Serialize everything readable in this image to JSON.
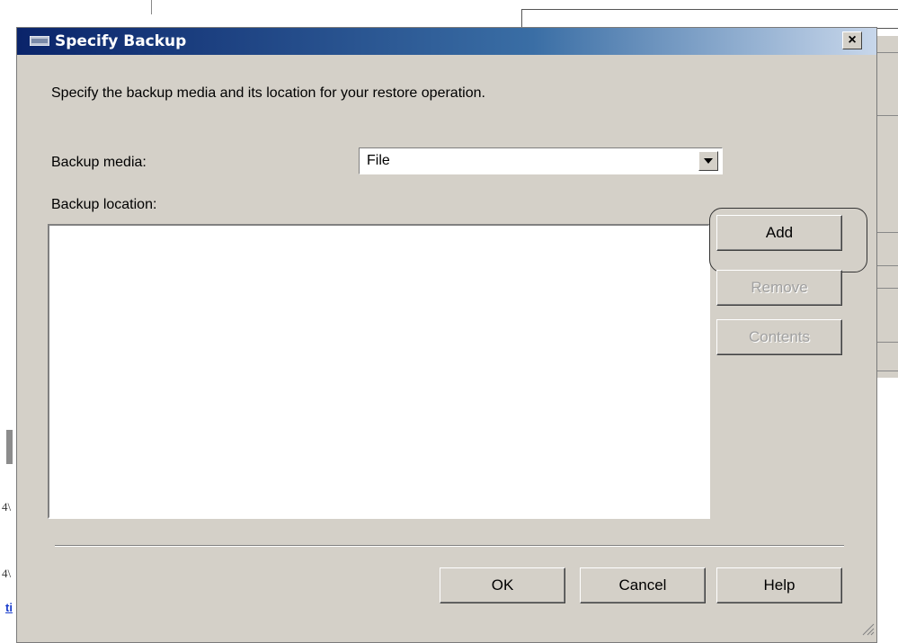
{
  "background": {
    "left_fragment_1": "4\\",
    "left_fragment_2": "4\\",
    "left_link": "ti"
  },
  "dialog": {
    "title": "Specify Backup",
    "close_label": "×",
    "description": "Specify the backup media and its location for your restore operation.",
    "backup_media_label": "Backup media:",
    "backup_media_value": "File",
    "backup_location_label": "Backup location:",
    "backup_locations": [],
    "buttons": {
      "add": "Add",
      "remove": "Remove",
      "contents": "Contents",
      "ok": "OK",
      "cancel": "Cancel",
      "help": "Help"
    }
  },
  "colors": {
    "dialog_bg": "#d4d0c8",
    "titlebar_start": "#0a246a",
    "titlebar_end": "#c8d7eb",
    "disabled_text": "#a0a0a0"
  }
}
